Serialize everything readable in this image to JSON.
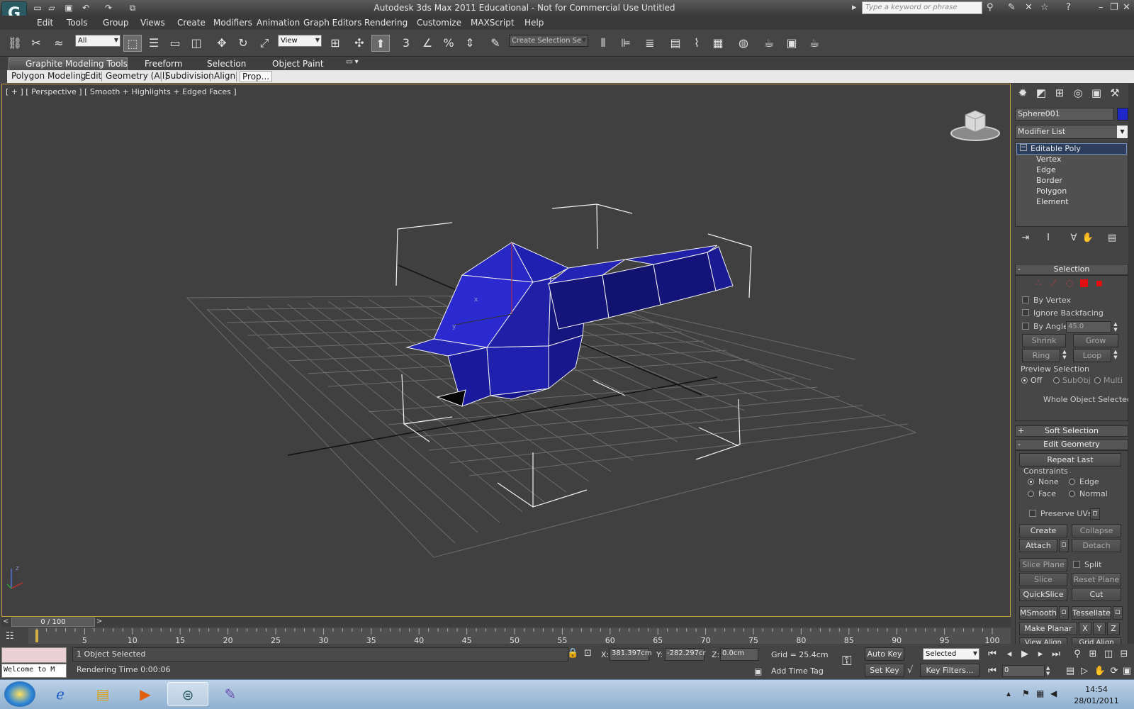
{
  "window": {
    "title": "Autodesk 3ds Max  2011    Educational - Not for Commercial Use    Untitled",
    "search_placeholder": "Type a keyword or phrase",
    "app_logo_glyph": "G"
  },
  "menu": [
    "Edit",
    "Tools",
    "Group",
    "Views",
    "Create",
    "Modifiers",
    "Animation",
    "Graph Editors",
    "Rendering",
    "Customize",
    "MAXScript",
    "Help"
  ],
  "toolbar": {
    "selection_filter": "All",
    "reference_coord": "View",
    "named_selection_placeholder": "Create Selection Se",
    "snap_label": "3"
  },
  "ribbon": {
    "tabs": [
      "Graphite Modeling Tools",
      "Freeform",
      "Selection",
      "Object Paint"
    ],
    "subtabs": [
      "Polygon Modeling",
      "Edit",
      "Geometry (All)",
      "Subdivision",
      "Align",
      "Prop..."
    ]
  },
  "viewport": {
    "label": "[ + ] [ Perspective ] [ Smooth + Highlights + Edged Faces ]",
    "axis_x": "x",
    "axis_y": "y",
    "axis_z": "z",
    "object_color": "#1e1ea8"
  },
  "command_panel": {
    "object_name": "Sphere001",
    "object_color": "#1e28c8",
    "modifier_list": "Modifier List",
    "stack": {
      "root": "Editable Poly",
      "items": [
        "Vertex",
        "Edge",
        "Border",
        "Polygon",
        "Element"
      ]
    },
    "selection": {
      "title": "Selection",
      "by_vertex": "By Vertex",
      "ignore_backfacing": "Ignore Backfacing",
      "by_angle": "By Angle:",
      "angle_value": "45.0",
      "shrink": "Shrink",
      "grow": "Grow",
      "ring": "Ring",
      "loop": "Loop",
      "preview_selection": "Preview Selection",
      "preview_off": "Off",
      "preview_subobj": "SubObj",
      "preview_multi": "Multi",
      "status": "Whole Object Selected"
    },
    "soft_selection": {
      "sign": "+",
      "title": "Soft Selection"
    },
    "edit_geometry": {
      "sign": "-",
      "title": "Edit Geometry",
      "repeat_last": "Repeat Last",
      "constraints": "Constraints",
      "none": "None",
      "edge": "Edge",
      "face": "Face",
      "normal": "Normal",
      "preserve_uvs": "Preserve UVs",
      "create": "Create",
      "collapse": "Collapse",
      "attach": "Attach",
      "detach": "Detach",
      "slice_plane": "Slice Plane",
      "split": "Split",
      "slice": "Slice",
      "reset_plane": "Reset Plane",
      "quickslice": "QuickSlice",
      "cut": "Cut",
      "msmooth": "MSmooth",
      "tessellate": "Tessellate",
      "make_planar": "Make Planar",
      "x": "X",
      "y": "Y",
      "z": "Z",
      "view_align": "View Align",
      "grid_align": "Grid Align"
    },
    "collapse_sign": "-"
  },
  "timeline": {
    "frame": "0 / 100",
    "ticks": [
      "5",
      "10",
      "15",
      "20",
      "25",
      "30",
      "35",
      "40",
      "45",
      "50",
      "55",
      "60",
      "65",
      "70",
      "75",
      "80",
      "85",
      "90",
      "95",
      "100"
    ]
  },
  "status": {
    "listener": "Welcome to M",
    "selection": "1 Object Selected",
    "render_time": "Rendering Time  0:00:06",
    "x_label": "X:",
    "x_value": "381.397cm",
    "y_label": "Y:",
    "y_value": "-282.297cr",
    "z_label": "Z:",
    "z_value": "0.0cm",
    "grid": "Grid = 25.4cm",
    "add_time_tag": "Add Time Tag",
    "auto_key": "Auto Key",
    "set_key": "Set Key",
    "key_mode": "Selected",
    "key_filters": "Key Filters...",
    "frame_field": "0"
  },
  "taskbar": {
    "time": "14:54",
    "date": "28/01/2011"
  }
}
